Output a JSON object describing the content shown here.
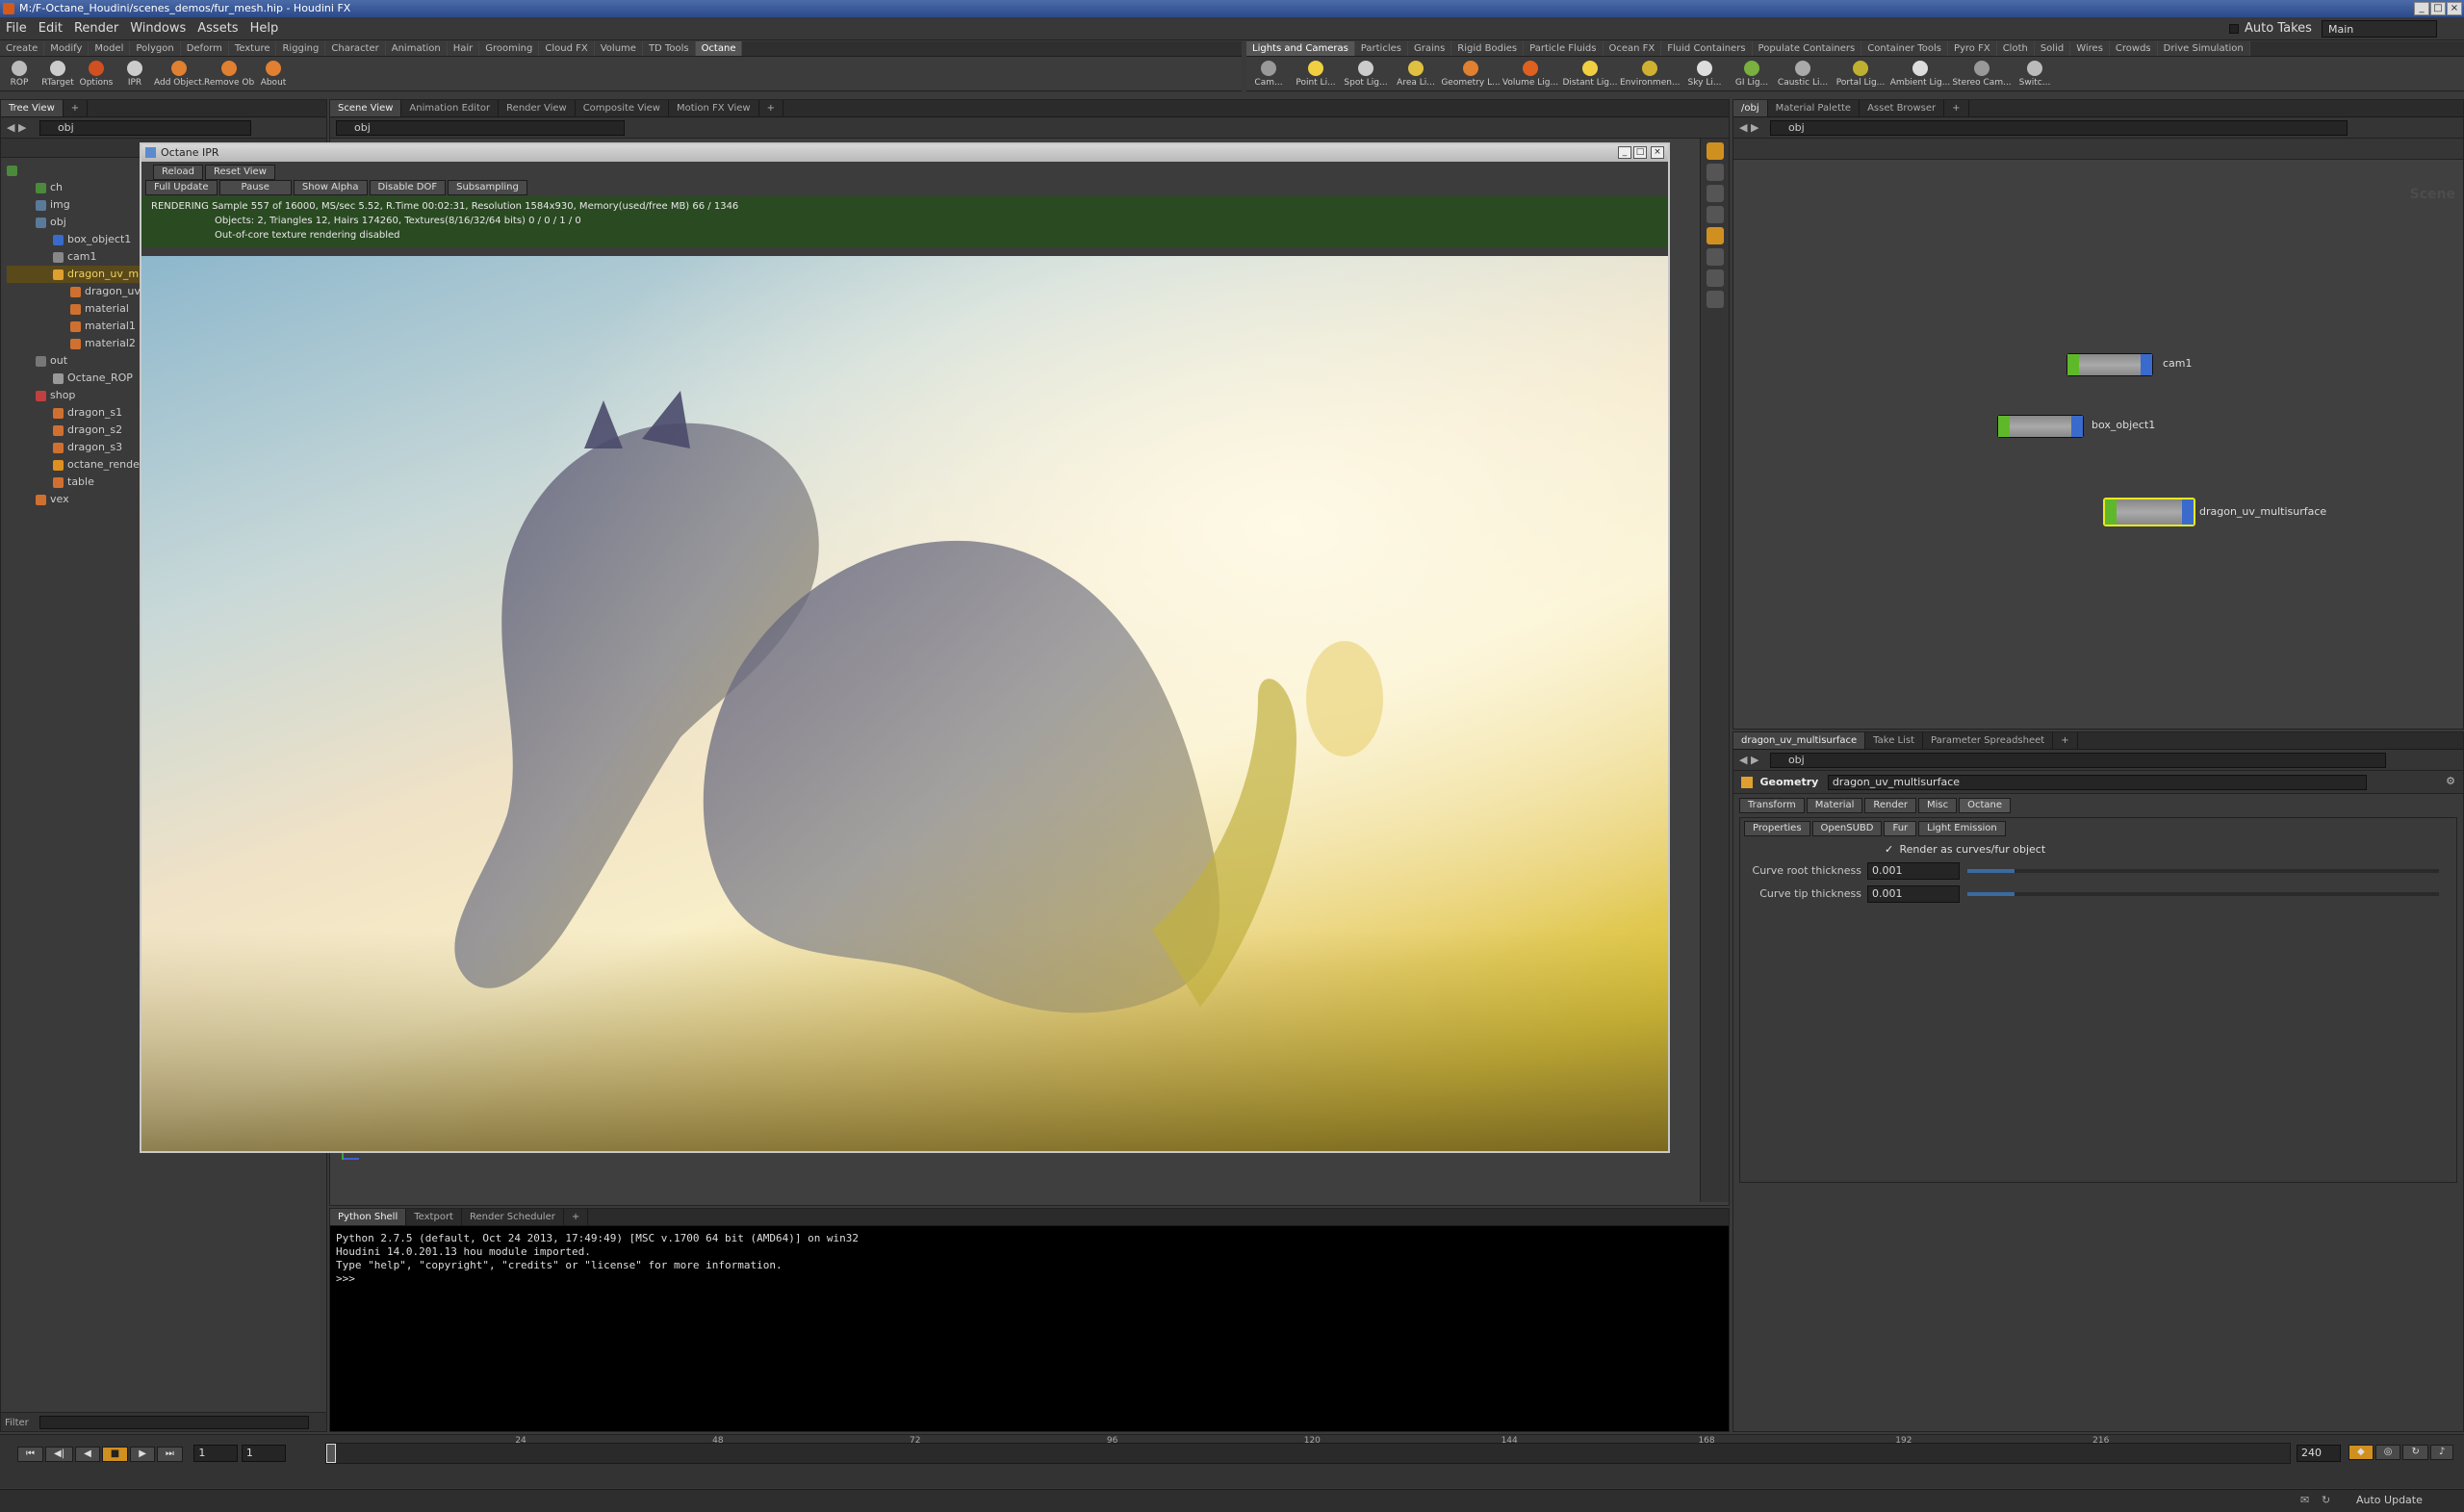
{
  "window": {
    "title": "M:/F-Octane_Houdini/scenes_demos/fur_mesh.hip - Houdini FX"
  },
  "menubar": {
    "items": [
      "File",
      "Edit",
      "Render",
      "Windows",
      "Assets",
      "Help"
    ],
    "auto_takes": "Auto Takes",
    "desktop": "Main"
  },
  "shelf_left": {
    "tabs": [
      "Create",
      "Modify",
      "Model",
      "Polygon",
      "Deform",
      "Texture",
      "Rigging",
      "Character",
      "Animation",
      "Hair",
      "Grooming",
      "Cloud FX",
      "Volume",
      "TD Tools",
      "Octane"
    ],
    "tools": [
      "ROP",
      "RTarget",
      "Options",
      "IPR",
      "Add Object...",
      "Remove Ob...",
      "About"
    ]
  },
  "shelf_right": {
    "tabs": [
      "Lights and Cameras",
      "Particles",
      "Grains",
      "Rigid Bodies",
      "Particle Fluids",
      "Ocean FX",
      "Fluid Containers",
      "Populate Containers",
      "Container Tools",
      "Pyro FX",
      "Cloth",
      "Solid",
      "Wires",
      "Crowds",
      "Drive Simulation"
    ],
    "tools": [
      "Cam...",
      "Point Li...",
      "Spot Lig...",
      "Area Li...",
      "Geometry L...",
      "Volume Lig...",
      "Distant Lig...",
      "Environmen...",
      "Sky Li...",
      "GI Lig...",
      "Caustic Li...",
      "Portal Lig...",
      "Ambient Lig...",
      "Stereo Cam...",
      "Switc..."
    ]
  },
  "treeview": {
    "tab": "Tree View",
    "path": "obj",
    "filter_label": "Filter",
    "rows": [
      "ch",
      "img",
      "obj",
      "box_object1",
      "cam1",
      "dragon_uv_multisurface",
      "dragon_uv_multisurface",
      "material",
      "material1",
      "material2",
      "out",
      "Octane_ROP",
      "shop",
      "dragon_s1",
      "dragon_s2",
      "dragon_s3",
      "octane_render",
      "table",
      "vex"
    ]
  },
  "viewer": {
    "tabs": [
      "Scene View",
      "Animation Editor",
      "Render View",
      "Composite View",
      "Motion FX View"
    ],
    "path": "obj"
  },
  "ipr": {
    "title": "Octane IPR",
    "buttons_row1": [
      "Reload",
      "Reset View"
    ],
    "buttons_row2": [
      "Full Update",
      "Pause",
      "Show Alpha",
      "Disable DOF",
      "Subsampling"
    ],
    "status_line1": "RENDERING Sample 557 of 16000,  MS/sec 5.52,  R.Time 00:02:31,  Resolution 1584x930,  Memory(used/free MB) 66 / 1346",
    "status_line2": "Objects: 2,  Triangles 12,  Hairs 174260,  Textures(8/16/32/64 bits) 0 / 0 / 1 / 0",
    "status_line3": "Out-of-core texture rendering disabled"
  },
  "shell": {
    "tabs": [
      "Python Shell",
      "Textport",
      "Render Scheduler"
    ],
    "lines": [
      "Python 2.7.5 (default, Oct 24 2013, 17:49:49) [MSC v.1700 64 bit (AMD64)] on win32",
      "Houdini 14.0.201.13 hou module imported.",
      "Type \"help\", \"copyright\", \"credits\" or \"license\" for more information.",
      ">>>"
    ]
  },
  "network": {
    "tabs": [
      "/obj",
      "Material Palette",
      "Asset Browser"
    ],
    "path": "obj",
    "watermark": "Scene",
    "nodes": [
      "cam1",
      "box_object1",
      "dragon_uv_multisurface"
    ]
  },
  "params": {
    "tabs": [
      "dragon_uv_multisurface",
      "Take List",
      "Parameter Spreadsheet"
    ],
    "path": "obj",
    "type_label": "Geometry",
    "node_name": "dragon_uv_multisurface",
    "main_tabs": [
      "Transform",
      "Material",
      "Render",
      "Misc",
      "Octane"
    ],
    "sub_tabs": [
      "Properties",
      "OpenSUBD",
      "Fur",
      "Light Emission"
    ],
    "checkbox_label": "Render as curves/fur object",
    "fields": [
      {
        "label": "Curve root thickness",
        "value": "0.001",
        "fraction": 0.1
      },
      {
        "label": "Curve tip thickness",
        "value": "0.001",
        "fraction": 0.1
      }
    ]
  },
  "timeline": {
    "frame": "1",
    "start": "1",
    "end": "240",
    "ticks": [
      "24",
      "48",
      "72",
      "96",
      "120",
      "144",
      "168",
      "192",
      "216"
    ],
    "auto_update": "Auto Update"
  }
}
